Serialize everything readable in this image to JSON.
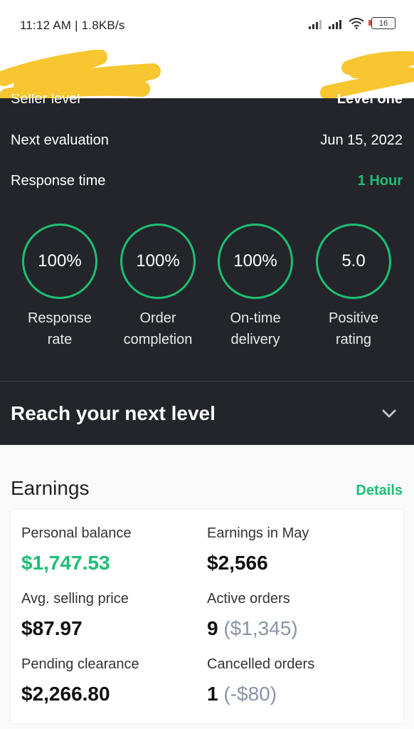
{
  "status_bar": {
    "time_speed": "11:12 AM | 1.8KB/s",
    "battery": "16"
  },
  "seller": {
    "level_label": "Seller level",
    "level_value": "Level one",
    "next_eval_label": "Next evaluation",
    "next_eval_value": "Jun 15, 2022",
    "response_time_label": "Response time",
    "response_time_value": "1 Hour"
  },
  "metrics": [
    {
      "value": "100%",
      "label_line1": "Response",
      "label_line2": "rate"
    },
    {
      "value": "100%",
      "label_line1": "Order",
      "label_line2": "completion"
    },
    {
      "value": "100%",
      "label_line1": "On-time",
      "label_line2": "delivery"
    },
    {
      "value": "5.0",
      "label_line1": "Positive",
      "label_line2": "rating"
    }
  ],
  "reach": {
    "title": "Reach your next level"
  },
  "earnings": {
    "title": "Earnings",
    "details": "Details",
    "personal_balance_label": "Personal balance",
    "personal_balance_value": "$1,747.53",
    "earnings_may_label": "Earnings in May",
    "earnings_may_value": "$2,566",
    "avg_price_label": "Avg. selling price",
    "avg_price_value": "$87.97",
    "active_orders_label": "Active orders",
    "active_orders_count": "9",
    "active_orders_amount": "($1,345)",
    "pending_label": "Pending clearance",
    "pending_value": "$2,266.80",
    "cancelled_label": "Cancelled orders",
    "cancelled_count": "1",
    "cancelled_amount": "(-$80)"
  },
  "colors": {
    "accent": "#1dbf73",
    "dark_panel": "#23252b",
    "redaction": "#f7c630"
  }
}
